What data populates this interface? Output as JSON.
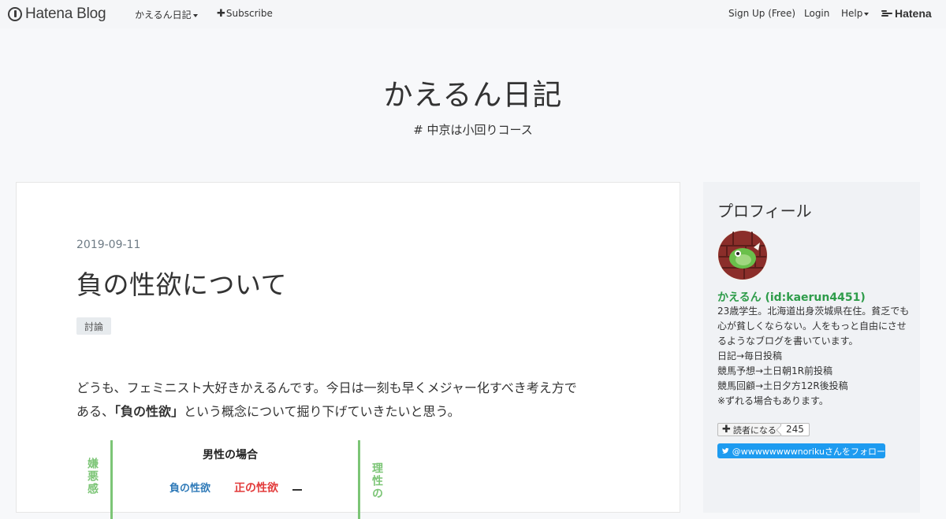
{
  "topbar": {
    "logo_text": "Hatena Blog",
    "blog_menu_label": "かえるん日記",
    "subscribe_label": "Subscribe",
    "signup_label": "Sign Up (Free)",
    "login_label": "Login",
    "help_label": "Help",
    "brand_label": "Hatena"
  },
  "blog": {
    "title": "かえるん日記",
    "description": "# 中京は小回りコース"
  },
  "entry": {
    "date": "2019-09-11",
    "title": "負の性欲について",
    "category": "討論",
    "body_line1": "どうも、フェミニスト大好きかえるんです。今日は一刻も早くメジャー化すべき考え方で",
    "body_line2_before": "ある、",
    "body_line2_strong": "「負の性欲」",
    "body_line2_after": "という概念について掘り下げていきたいと思う。",
    "diagram": {
      "title": "男性の場合",
      "left_label": "嫌悪感",
      "right_label": "理性の",
      "negative_label": "負の性欲",
      "positive_label": "正の性欲"
    }
  },
  "sidebar": {
    "heading": "プロフィール",
    "user_name": "かえるん (id:kaerun4451)",
    "bio_lines": [
      "23歳学生。北海道出身茨城県在住。貧乏でも",
      "心が貧しくならない。人をもっと自由にさせ",
      "るようなブログを書いています。",
      "日記→毎日投稿",
      "競馬予想→土日朝1R前投稿",
      "競馬回顧→土日夕方12R後投稿",
      "※ずれる場合もあります。"
    ],
    "reader_button_label": "読者になる",
    "reader_count": "245",
    "twitter_follow_label": "@wwwwwwwwnorikuさんをフォロー"
  },
  "colors": {
    "accent_green": "#2e9c4a",
    "twitter_blue": "#1d9bf0",
    "diagram_green": "#7cc576",
    "negative_blue": "#2f7ab8",
    "positive_red": "#e23a3a"
  },
  "icons": [
    "hatena-blog-logo-icon",
    "caret-down-icon",
    "plus-icon",
    "hatena-brand-icon",
    "twitter-bird-icon",
    "avatar-frog"
  ]
}
